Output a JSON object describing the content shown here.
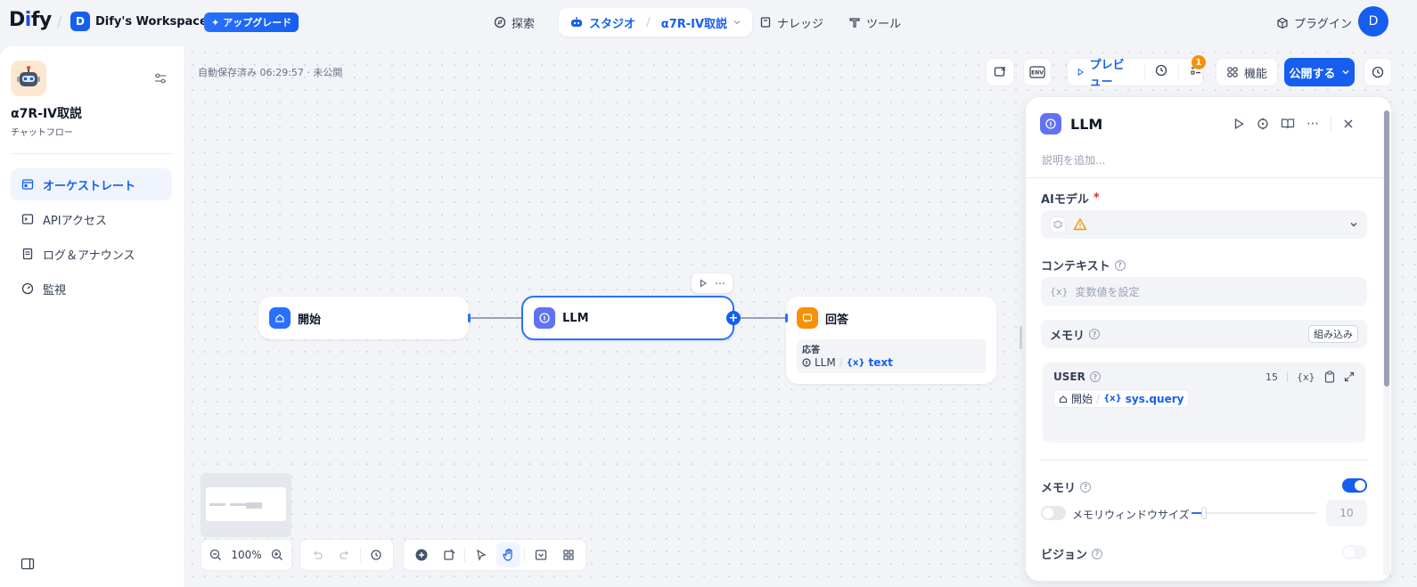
{
  "topbar": {
    "logo_text": "Dify",
    "workspace_initial": "D",
    "workspace_name": "Dify's Workspace",
    "upgrade_label": "アップグレード",
    "nav": {
      "explore": "探索",
      "studio": "スタジオ",
      "app_name": "α7R-IV取説",
      "knowledge": "ナレッジ",
      "tools": "ツール"
    },
    "plugin_label": "プラグイン",
    "user_initial": "D"
  },
  "sidebar": {
    "app_title": "α7R-IV取説",
    "app_type": "チャットフロー",
    "items": [
      {
        "label": "オーケストレート",
        "icon": "layout-icon",
        "active": true
      },
      {
        "label": "APIアクセス",
        "icon": "terminal-icon",
        "active": false
      },
      {
        "label": "ログ＆アナウンス",
        "icon": "file-list-icon",
        "active": false
      },
      {
        "label": "監視",
        "icon": "dashboard-icon",
        "active": false
      }
    ]
  },
  "canvas": {
    "autosave_text": "自動保存済み 06:29:57 · 未公開",
    "zoom": "100%",
    "nodes": {
      "start": {
        "title": "開始",
        "color": "#2970ff"
      },
      "llm": {
        "title": "LLM",
        "color": "#6172f3"
      },
      "answer": {
        "title": "回答",
        "color": "#f79009",
        "output_label": "応答",
        "output_source": "LLM",
        "output_var": "text",
        "var_prefix": "{x}"
      }
    }
  },
  "toolbar": {
    "preview_label": "プレビュー",
    "checklist_count": "1",
    "features_label": "機能",
    "publish_label": "公開する",
    "env_label": "ENV"
  },
  "panel": {
    "title": "LLM",
    "desc_placeholder": "説明を追加...",
    "model_label": "AIモデル",
    "required_mark": "*",
    "context_label": "コンテキスト",
    "context_placeholder": "変数値を設定",
    "var_prefix": "{x}",
    "memory_section_label": "メモリ",
    "builtin_label": "組み込み",
    "user_label": "USER",
    "user_count": "15",
    "user_var_node": "開始",
    "user_var_name": "sys.query",
    "memory_label": "メモリ",
    "memory_enabled": true,
    "window_label": "メモリウィンドウサイズ",
    "window_enabled": false,
    "window_value": "10",
    "window_slider_fraction": 0.1,
    "vision_label": "ビジョン",
    "vision_enabled": false
  },
  "colors": {
    "primary": "#155eef",
    "warning": "#f79009"
  }
}
